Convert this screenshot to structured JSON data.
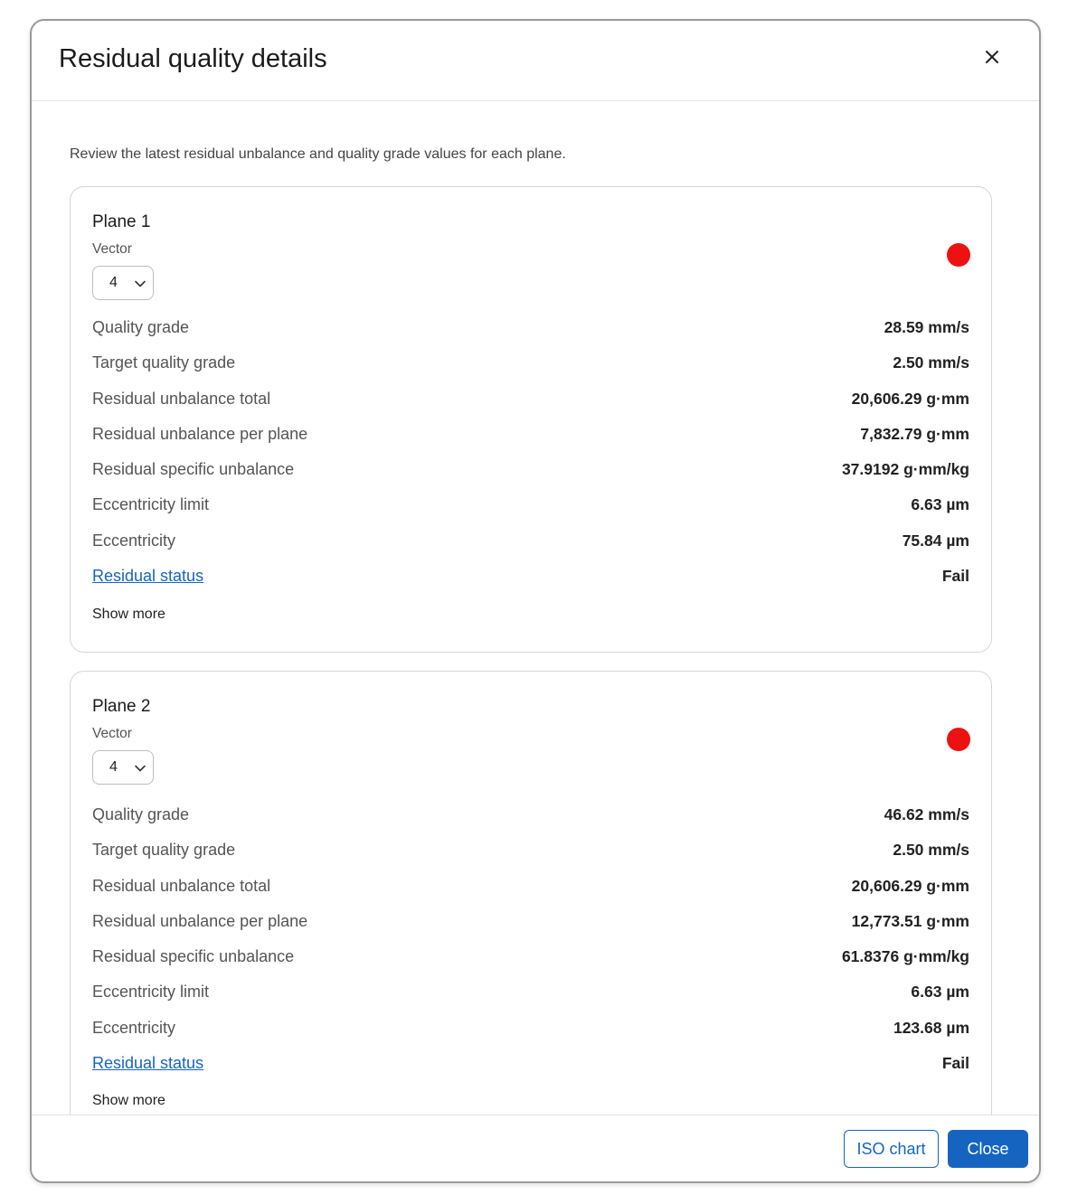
{
  "dialog": {
    "title": "Residual quality details",
    "intro": "Review the latest residual unbalance and quality grade values for each plane.",
    "close_icon": "close-icon"
  },
  "planes": [
    {
      "title": "Plane 1",
      "vector_label": "Vector",
      "vector_value": "4",
      "status_color": "#ee1111",
      "rows": [
        {
          "label": "Quality grade",
          "value": "28.59 mm/s"
        },
        {
          "label": "Target quality grade",
          "value": "2.50 mm/s"
        },
        {
          "label": "Residual unbalance total",
          "value": "20,606.29 g·mm"
        },
        {
          "label": "Residual unbalance per plane",
          "value": "7,832.79 g·mm"
        },
        {
          "label": "Residual specific unbalance",
          "value": "37.9192 g·mm/kg"
        },
        {
          "label": "Eccentricity limit",
          "value": "6.63 µm"
        },
        {
          "label": "Eccentricity",
          "value": "75.84 µm"
        },
        {
          "label": "Residual status",
          "value": "Fail"
        }
      ],
      "show_more": "Show more"
    },
    {
      "title": "Plane 2",
      "vector_label": "Vector",
      "vector_value": "4",
      "status_color": "#ee1111",
      "rows": [
        {
          "label": "Quality grade",
          "value": "46.62 mm/s"
        },
        {
          "label": "Target quality grade",
          "value": "2.50 mm/s"
        },
        {
          "label": "Residual unbalance total",
          "value": "20,606.29 g·mm"
        },
        {
          "label": "Residual unbalance per plane",
          "value": "12,773.51 g·mm"
        },
        {
          "label": "Residual specific unbalance",
          "value": "61.8376 g·mm/kg"
        },
        {
          "label": "Eccentricity limit",
          "value": "6.63 µm"
        },
        {
          "label": "Eccentricity",
          "value": "123.68 µm"
        },
        {
          "label": "Residual status",
          "value": "Fail"
        }
      ],
      "show_more": "Show more"
    }
  ],
  "footer": {
    "iso_chart_label": "ISO chart",
    "close_label": "Close"
  },
  "colors": {
    "accent": "#1565c0",
    "fail": "#ee1111"
  }
}
